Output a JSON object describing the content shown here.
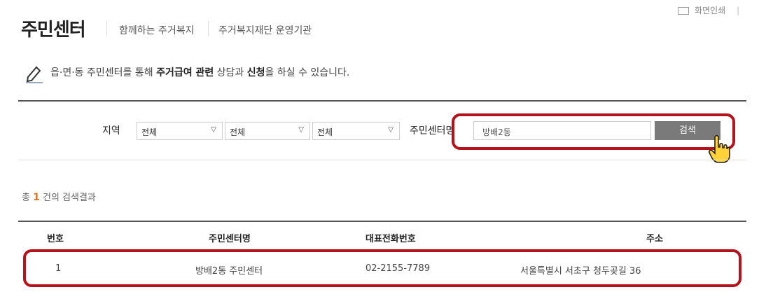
{
  "header": {
    "title": "주민센터",
    "nav": [
      "함께하는 주거복지",
      "주거복지재단 운영기관"
    ],
    "util_print": "화면인쇄"
  },
  "notice": {
    "pre": "읍·면·동 주민센터를 통해 ",
    "bold1": "주거급여 관련",
    "mid": " 상담과 ",
    "bold2": "신청",
    "post": "을 하실 수 있습니다."
  },
  "search": {
    "region_label": "지역",
    "selects": [
      "전체",
      "전체",
      "전체"
    ],
    "center_label": "주민센터명",
    "input_value": "방배2동",
    "button_label": "검색"
  },
  "result": {
    "prefix": "총",
    "count": "1",
    "suffix": "건의 검색결과"
  },
  "table": {
    "headers": [
      "번호",
      "주민센터명",
      "대표전화번호",
      "주소"
    ],
    "rows": [
      [
        "1",
        "방배2동 주민센터",
        "02-2155-7789",
        "서울특별시 서초구 청두곶길 36"
      ]
    ]
  },
  "icons": {
    "notice": "pencil-icon",
    "select_arrow": "chevron-down-icon",
    "cursor": "hand-pointer-icon",
    "print": "print-icon"
  },
  "colors": {
    "highlight": "#b5121b",
    "count": "#e2730e",
    "button": "#7a7a7a"
  }
}
